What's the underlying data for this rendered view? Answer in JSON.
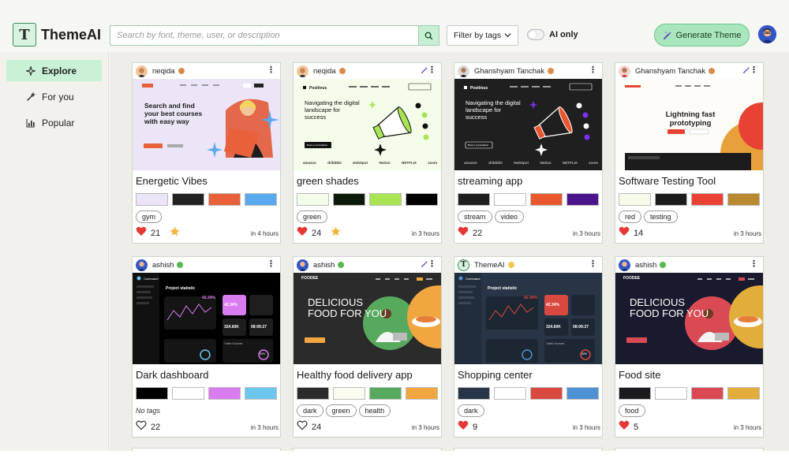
{
  "app": {
    "name": "ThemeAI",
    "logo_glyph": "T"
  },
  "search": {
    "placeholder": "Search by font, theme, user, or description"
  },
  "filter": {
    "label": "Filter by tags"
  },
  "ai_only": {
    "label": "AI only",
    "enabled": false
  },
  "generate": {
    "label": "Generate Theme"
  },
  "sidebar": {
    "items": [
      {
        "label": "Explore",
        "icon": "sparkle-icon",
        "active": true
      },
      {
        "label": "For you",
        "icon": "magic-wand-icon",
        "active": false
      },
      {
        "label": "Popular",
        "icon": "bar-chart-icon",
        "active": false
      }
    ]
  },
  "colors": {
    "accent": "#a9e6bd",
    "accent_border": "#6bc788",
    "active_nav": "#c9f1d6",
    "heart": "#e53935",
    "star": "#f2b33d"
  },
  "cards": [
    {
      "user": "neqida",
      "title": "Energetic Vibes",
      "swatches": [
        "#ece4f7",
        "#222222",
        "#e8613a",
        "#58a9ee"
      ],
      "tags": [
        "gym"
      ],
      "likes": "21",
      "liked": true,
      "starred": true,
      "ago": "in 4 hours",
      "thumb": {
        "headline": "Search and find your best courses with easy way"
      }
    },
    {
      "user": "neqida",
      "title": "green shades",
      "swatches": [
        "#f4fde9",
        "#0e1a0a",
        "#a8e453",
        "#000000"
      ],
      "tags": [
        "green"
      ],
      "likes": "24",
      "liked": true,
      "starred": true,
      "ago": "in 3 hours",
      "thumb": {
        "brand": "Positivus",
        "headline": "Navigating the digital landscape for success",
        "cta": "Book a consultation",
        "logos": [
          "amazon",
          "dribbble",
          "HubSpot",
          "Notion",
          "NETFLIX",
          "zoom"
        ]
      }
    },
    {
      "user": "Ghanshyam Tanchak",
      "title": "streaming app",
      "swatches": [
        "#1f1f1f",
        "#ffffff",
        "#e9572e",
        "#4a148c"
      ],
      "tags": [
        "stream",
        "video"
      ],
      "likes": "22",
      "liked": true,
      "starred": false,
      "ago": "in 3 hours",
      "thumb": {
        "brand": "Positivus",
        "headline": "Navigating the digital landscape for success",
        "cta": "Book a consultation",
        "logos": [
          "amazon",
          "dribbble",
          "HubSpot",
          "Notion",
          "NETFLIX",
          "zoom"
        ]
      }
    },
    {
      "user": "Ghanshyam Tanchak",
      "title": "Software Testing Tool",
      "swatches": [
        "#f7fbe9",
        "#1c1c1c",
        "#e94235",
        "#b98a2f"
      ],
      "tags": [
        "red",
        "testing"
      ],
      "likes": "14",
      "liked": true,
      "starred": false,
      "ago": "in 3 hours",
      "thumb": {
        "headline": "Lightning fast prototyping"
      }
    },
    {
      "user": "ashish",
      "title": "Dark dashboard",
      "swatches": [
        "#000000",
        "#ffffff",
        "#d87cf0",
        "#6cc6ee"
      ],
      "tags": [],
      "no_tags": "No tags",
      "likes": "22",
      "liked": false,
      "starred": false,
      "ago": "in 3 hours",
      "thumb": {
        "brand": "Command",
        "headline": "Project statistic",
        "stats": [
          "42.34%",
          "324.60K",
          "08:09:27",
          "Traffic Sources",
          "50%"
        ]
      }
    },
    {
      "user": "ashish",
      "title": "Healthy food delivery app",
      "swatches": [
        "#2b2b2b",
        "#fbfbf1",
        "#57a95e",
        "#f2a640"
      ],
      "tags": [
        "dark",
        "green",
        "health"
      ],
      "likes": "24",
      "liked": false,
      "starred": false,
      "ago": "in 3 hours",
      "thumb": {
        "brand": "FOODEE",
        "headline1": "DELICIOUS",
        "headline2": "FOOD FOR YOU"
      }
    },
    {
      "user": "ThemeAI",
      "title": "Shopping center",
      "swatches": [
        "#283546",
        "#ffffff",
        "#d9493f",
        "#4e91d4"
      ],
      "tags": [
        "dark"
      ],
      "likes": "9",
      "liked": true,
      "starred": false,
      "ago": "in 3 hours",
      "thumb": {
        "brand": "Command",
        "headline": "Project statistic",
        "stats": [
          "42.34%",
          "324.60K",
          "08:09:27",
          "Traffic Sources",
          "50%"
        ]
      }
    },
    {
      "user": "ashish",
      "title": "Food site",
      "swatches": [
        "#1a1a1f",
        "#ffffff",
        "#d94a54",
        "#e3ad3c"
      ],
      "tags": [
        "food"
      ],
      "likes": "5",
      "liked": true,
      "starred": false,
      "ago": "in 3 hours",
      "thumb": {
        "brand": "FOODEE",
        "headline1": "DELICIOUS",
        "headline2": "FOOD FOR YOU"
      }
    }
  ]
}
